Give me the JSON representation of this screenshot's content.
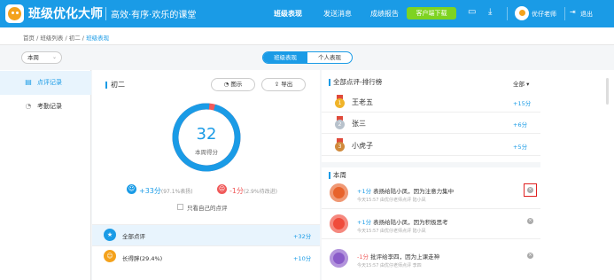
{
  "header": {
    "brand": "班级优化大师",
    "slogan": "高效·有序·欢乐的课堂",
    "nav": [
      "班级表现",
      "发送消息",
      "成绩报告"
    ],
    "download": "客户端下载",
    "user": "优仔老师",
    "logout": "退出",
    "colors": {
      "primary": "#1a9be6",
      "download": "#7ed321"
    }
  },
  "breadcrumb": {
    "items": [
      "首页",
      "班级列表",
      "初二"
    ],
    "current": "班级表现",
    "sep": "/"
  },
  "filters": {
    "period": "本周",
    "view_tabs": [
      "班级表现",
      "个人表现"
    ],
    "active_tab": 0
  },
  "sidebar": {
    "items": [
      "点评记录",
      "考勤记录"
    ],
    "selected": 0
  },
  "class_panel": {
    "class_name": "初二",
    "chart_btn": "图示",
    "export_btn": "导出",
    "score": "32",
    "score_label": "本周得分",
    "positive_ratio": 0.971,
    "positive": "+33分",
    "positive_note": "(97.1%表扬)",
    "negative": "-1分",
    "negative_note": "(2.9%待改进)",
    "only_mine": "只看自己的点评",
    "rows": [
      {
        "label": "全部点评",
        "value": "+32分"
      },
      {
        "label": "长得胖(29.4%)",
        "value": "+10分"
      }
    ]
  },
  "ranking": {
    "title": "全部点评-排行榜",
    "filter": "全部",
    "items": [
      {
        "name": "王老五",
        "value": "+15分",
        "medal": "#f0b429"
      },
      {
        "name": "张三",
        "value": "+6分",
        "medal": "#b8c2cc"
      },
      {
        "name": "小虎子",
        "value": "+5分",
        "medal": "#d08a3c"
      }
    ]
  },
  "week": {
    "title": "本周",
    "items": [
      {
        "score": "+1分",
        "text": "表扬给陆小凤，因为注意力集中",
        "sub": "今天15:57 由优仔老师点评 陆小凤",
        "icon": "target-icon",
        "color": "#e8632b"
      },
      {
        "score": "+1分",
        "text": "表扬给陆小凤，因为积极思考",
        "sub": "今天15:57 由优仔老师点评 陆小凤",
        "icon": "lightbulb-icon",
        "color": "#f04b3b"
      },
      {
        "score": "-1分",
        "text": "批评给李四，因为上课走神",
        "sub": "今天15:57 由优仔老师点评 李四",
        "icon": "search-icon",
        "color": "#8a5bc9"
      }
    ]
  }
}
